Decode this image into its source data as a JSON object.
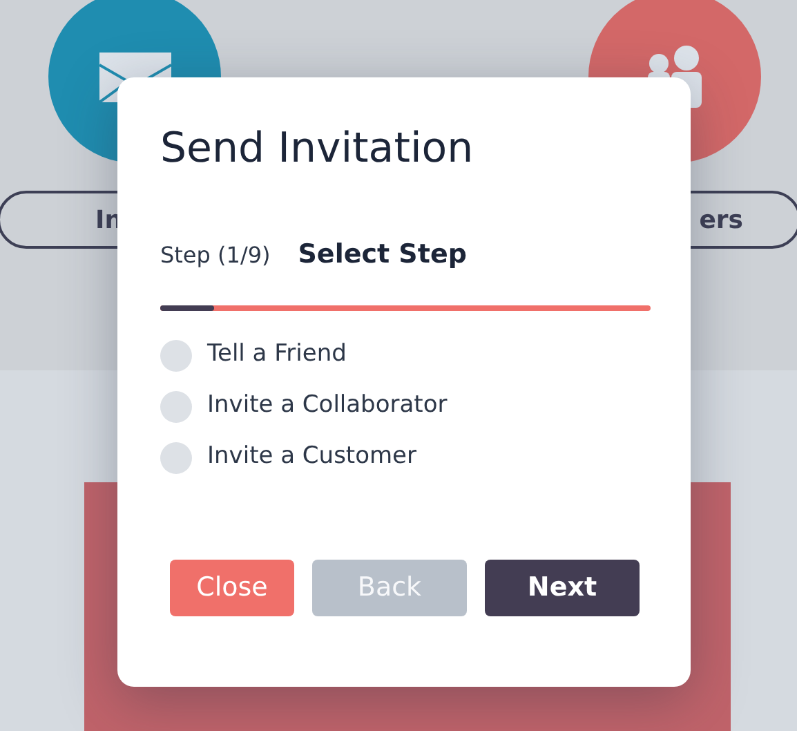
{
  "background": {
    "left_pill": {
      "label": "In"
    },
    "right_pill": {
      "label": "ers"
    }
  },
  "dialog": {
    "title": "Send Invitation",
    "step_counter": "Step (1/9)",
    "step_title": "Select Step",
    "progress": {
      "level": 0.11
    },
    "options": [
      {
        "label": "Tell a Friend",
        "selected": false
      },
      {
        "label": "Invite a Collaborator",
        "selected": false
      },
      {
        "label": "Invite a Customer",
        "selected": false
      }
    ],
    "buttons": [
      {
        "label": "Close",
        "kind": "close"
      },
      {
        "label": "Back",
        "kind": "back"
      },
      {
        "label": "Next",
        "kind": "next"
      }
    ]
  }
}
